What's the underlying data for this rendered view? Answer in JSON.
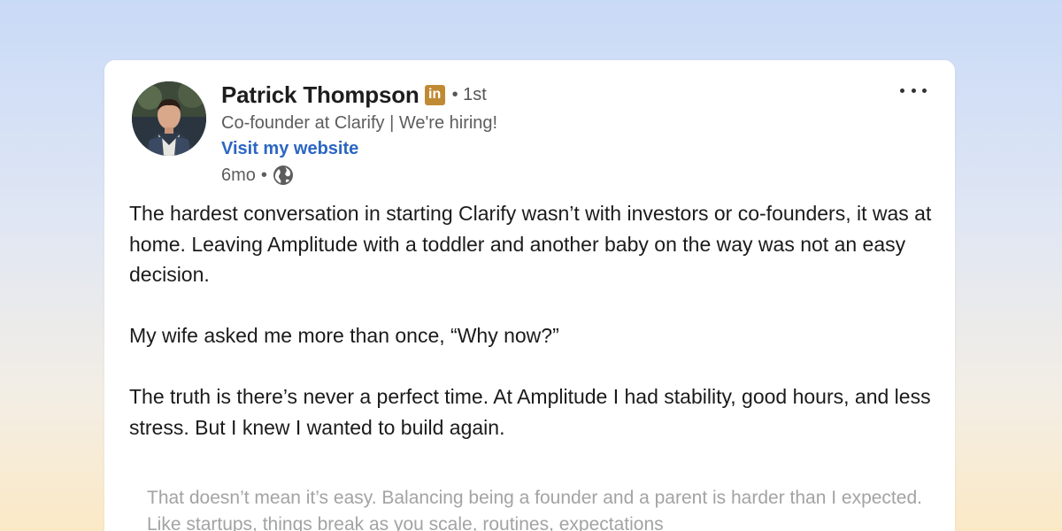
{
  "post": {
    "author": {
      "name": "Patrick Thompson",
      "badge": "in",
      "degree": "• 1st",
      "headline": "Co-founder at Clarify | We're hiring!",
      "website_link": "Visit my website",
      "time": "6mo",
      "time_sep": "•",
      "visibility_icon": "globe-icon"
    },
    "paragraphs": [
      "The hardest conversation in starting Clarify wasn’t with investors or co-founders, it was at home. Leaving Amplitude with a toddler and another baby on the way was not an easy decision.",
      "My wife asked me more than once, “Why now?”",
      "The truth is there’s never a perfect time. At Amplitude I had stability, good hours, and less stress. But I knew I wanted to build again."
    ],
    "faded_paragraph": "That doesn’t mean it’s easy. Balancing being a founder and a parent is harder than I expected. Like startups, things break as you scale, routines, expectations",
    "menu_icon": "more-horizontal-icon"
  },
  "colors": {
    "link": "#2b66c2",
    "badge": "#c08a34",
    "text": "#1b1b1b",
    "muted": "#5d5d5d"
  }
}
